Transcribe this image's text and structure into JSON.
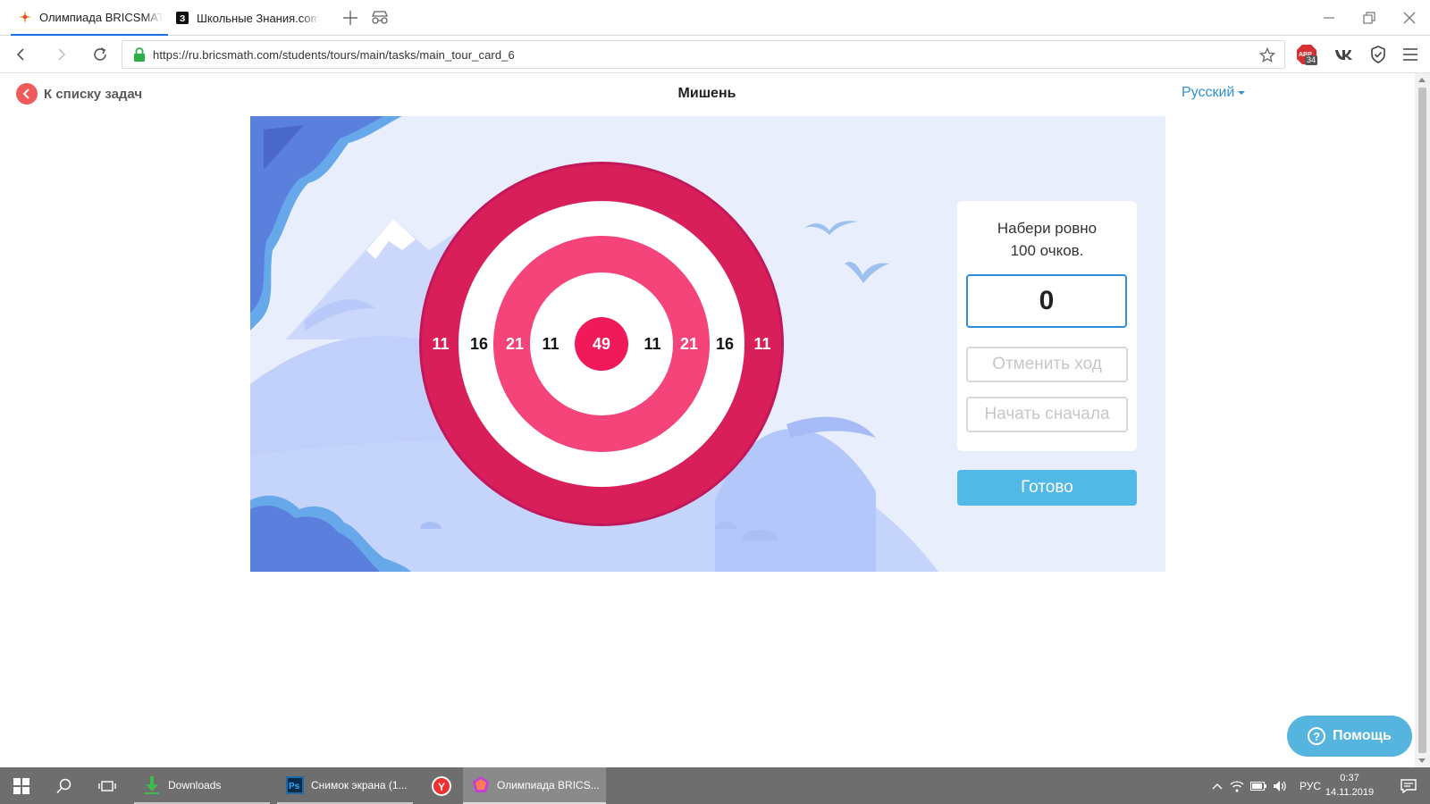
{
  "browser": {
    "tabs": [
      {
        "title": "Олимпиада BRICSMATH"
      },
      {
        "title": "Школьные Знания.com"
      }
    ],
    "url": "https://ru.bricsmath.com/students/tours/main/tasks/main_tour_card_6",
    "adblock_badge": "34"
  },
  "header": {
    "back_label": "К списку задач",
    "title": "Мишень",
    "language": "Русский"
  },
  "target": {
    "labels": [
      "11",
      "16",
      "21",
      "11",
      "49",
      "11",
      "21",
      "16",
      "11"
    ],
    "colors": {
      "outer": "#d81f5a",
      "mid": "#f4447a",
      "bullseye": "#f01a5a",
      "white": "#ffffff"
    }
  },
  "panel": {
    "task_line1": "Набери ровно",
    "task_line2": "100 очков.",
    "score": "0",
    "undo_label": "Отменить ход",
    "restart_label": "Начать сначала",
    "done_label": "Готово"
  },
  "help": {
    "label": "Помощь"
  },
  "taskbar": {
    "apps": [
      {
        "label": "Downloads"
      },
      {
        "label": "Снимок экрана (1..."
      },
      {
        "label": "Олимпиада BRICS..."
      }
    ],
    "language": "РУС",
    "time": "0:37",
    "date": "14.11.2019"
  }
}
